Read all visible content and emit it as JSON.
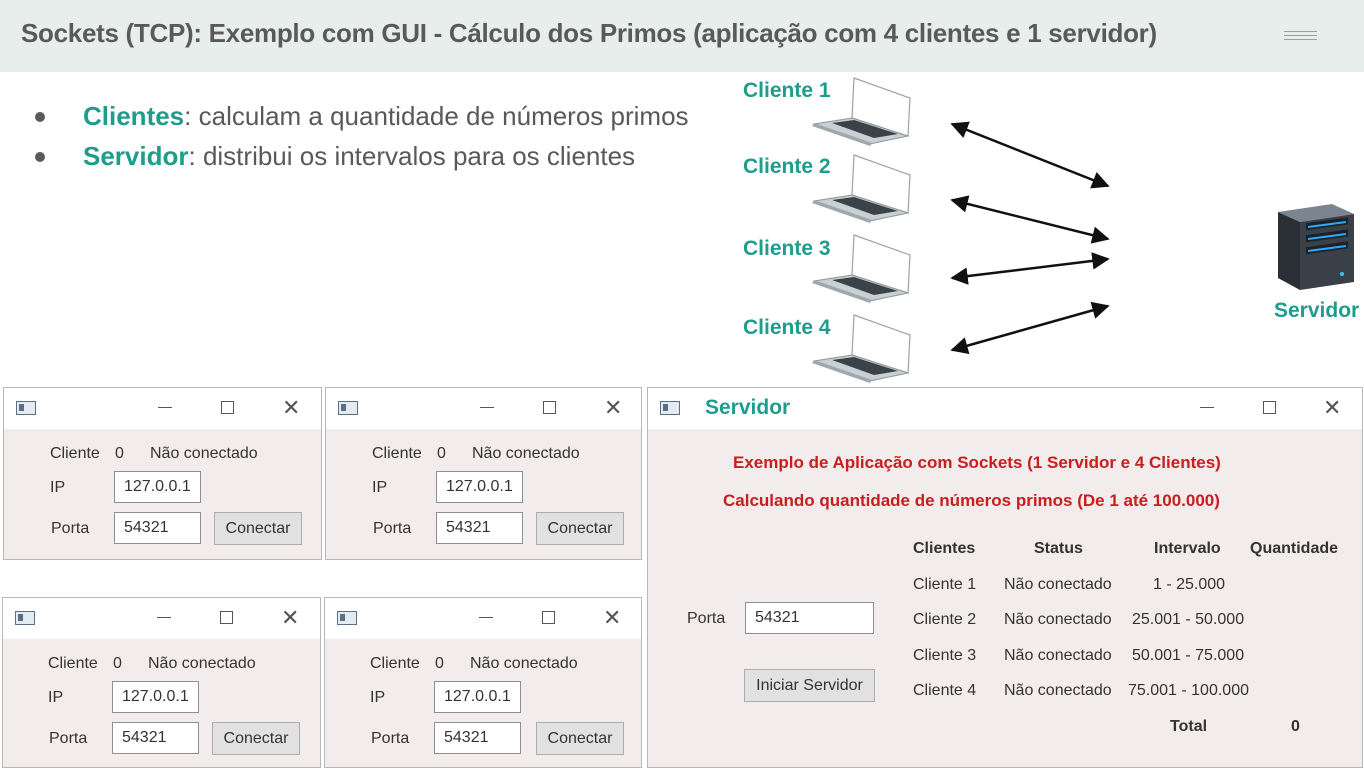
{
  "slide": {
    "title": "Sockets (TCP): Exemplo com GUI - Cálculo dos Primos (aplicação com 4 clientes e 1 servidor)",
    "bullets": [
      {
        "key": "Clientes",
        "text": ": calculam a quantidade de números primos"
      },
      {
        "key": "Servidor",
        "text": ": distribui os intervalos para os clientes"
      }
    ]
  },
  "diagram": {
    "clients": [
      "Cliente 1",
      "Cliente 2",
      "Cliente 3",
      "Cliente 4"
    ],
    "server_label": "Servidor",
    "icons": {
      "client": "laptop-icon",
      "server": "server-tower-icon"
    }
  },
  "client_windows": [
    {
      "cliente_label": "Cliente",
      "cliente_num": "0",
      "status": "Não conectado",
      "ip_label": "IP",
      "ip": "127.0.0.1",
      "porta_label": "Porta",
      "porta": "54321",
      "button": "Conectar"
    },
    {
      "cliente_label": "Cliente",
      "cliente_num": "0",
      "status": "Não conectado",
      "ip_label": "IP",
      "ip": "127.0.0.1",
      "porta_label": "Porta",
      "porta": "54321",
      "button": "Conectar"
    },
    {
      "cliente_label": "Cliente",
      "cliente_num": "0",
      "status": "Não conectado",
      "ip_label": "IP",
      "ip": "127.0.0.1",
      "porta_label": "Porta",
      "porta": "54321",
      "button": "Conectar"
    },
    {
      "cliente_label": "Cliente",
      "cliente_num": "0",
      "status": "Não conectado",
      "ip_label": "IP",
      "ip": "127.0.0.1",
      "porta_label": "Porta",
      "porta": "54321",
      "button": "Conectar"
    }
  ],
  "server_window": {
    "title": "Servidor",
    "heading1": "Exemplo de Aplicação com Sockets (1 Servidor e 4 Clientes)",
    "heading2": "Calculando quantidade de números primos (De 1 até 100.000)",
    "porta_label": "Porta",
    "porta": "54321",
    "button": "Iniciar Servidor",
    "table": {
      "headers": [
        "Clientes",
        "Status",
        "Intervalo",
        "Quantidade"
      ],
      "rows": [
        {
          "cliente": "Cliente 1",
          "status": "Não conectado",
          "intervalo": "1 - 25.000"
        },
        {
          "cliente": "Cliente 2",
          "status": "Não conectado",
          "intervalo": "25.001 - 50.000"
        },
        {
          "cliente": "Cliente 3",
          "status": "Não conectado",
          "intervalo": "50.001 - 75.000"
        },
        {
          "cliente": "Cliente 4",
          "status": "Não conectado",
          "intervalo": "75.001 - 100.000"
        }
      ],
      "total_label": "Total",
      "total_value": "0"
    }
  },
  "colors": {
    "accent": "#1f9c8c",
    "heading_red": "#c81e1e",
    "window_bg": "#f3ecec",
    "topbar_bg": "#e8eeec"
  }
}
